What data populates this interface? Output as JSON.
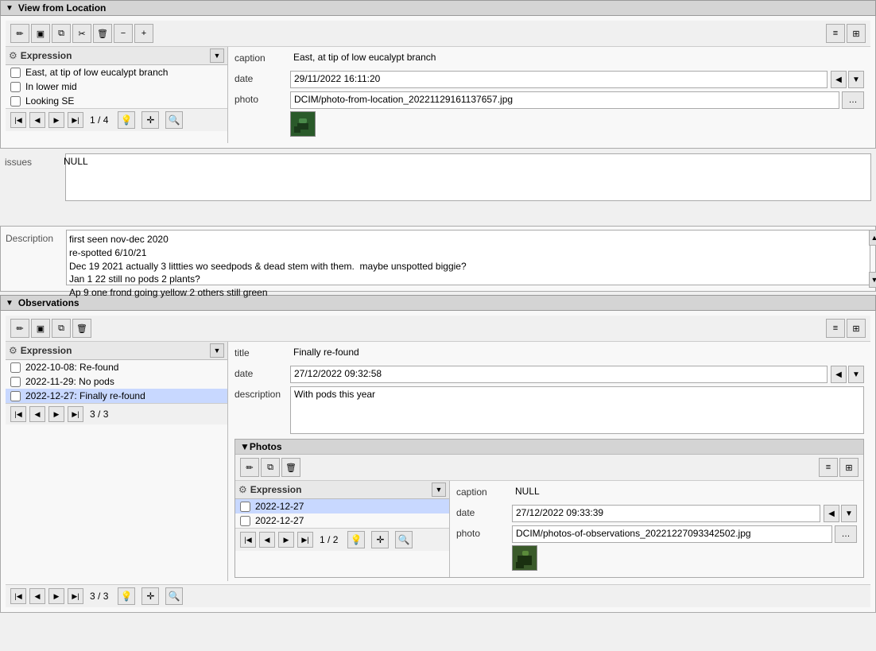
{
  "viewFromLocation": {
    "header": "View from Location",
    "toolbar": {
      "edit_icon": "✏️",
      "save_icon": "💾",
      "copy_icon": "📋",
      "delete_icon": "🗑",
      "minus_icon": "−",
      "plus_icon": "+",
      "table_icon": "≡",
      "grid_icon": "⊞"
    },
    "expression": {
      "label": "Expression",
      "items": [
        {
          "id": 1,
          "text": "East, at tip of low eucalypt branch",
          "checked": false
        },
        {
          "id": 2,
          "text": "In lower mid",
          "checked": false
        },
        {
          "id": 3,
          "text": "Looking SE",
          "checked": false
        }
      ]
    },
    "nav": {
      "current": "1",
      "total": "4"
    },
    "fields": {
      "caption_label": "caption",
      "caption_value": "East, at tip of low eucalypt branch",
      "date_label": "date",
      "date_value": "29/11/2022 16:11:20",
      "photo_label": "photo",
      "photo_path": "DCIM/photo-from-location_20221129161137657.jpg"
    }
  },
  "issues": {
    "label": "issues",
    "value": "NULL"
  },
  "description": {
    "label": "Description",
    "lines": [
      "first seen nov-dec 2020",
      "re-spotted 6/10/21",
      "Dec 19 2021 actually 3 littties wo seedpods & dead stem with them.  maybe unspotted biggie?",
      "Jan 1 22 still no pods 2 plants?",
      "Ap 9 one frond going yellow 2 others still green"
    ]
  },
  "observations": {
    "header": "Observations",
    "toolbar": {
      "edit_icon": "✏️",
      "save_icon": "💾",
      "copy_icon": "📋",
      "delete_icon": "🗑"
    },
    "expression": {
      "label": "Expression",
      "items": [
        {
          "id": 1,
          "text": "2022-10-08: Re-found",
          "checked": false
        },
        {
          "id": 2,
          "text": "2022-11-29: No pods",
          "checked": false
        },
        {
          "id": 3,
          "text": "2022-12-27: Finally re-found",
          "checked": false
        }
      ]
    },
    "nav": {
      "current": "3",
      "total": "3"
    },
    "fields": {
      "title_label": "title",
      "title_value": "Finally re-found",
      "date_label": "date",
      "date_value": "27/12/2022 09:32:58",
      "description_label": "description",
      "description_value": "With pods this year"
    },
    "photos": {
      "header": "Photos",
      "toolbar": {
        "edit_icon": "✏️",
        "copy_icon": "📋",
        "delete_icon": "🗑"
      },
      "expression": {
        "label": "Expression",
        "items": [
          {
            "id": 1,
            "text": "2022-12-27",
            "checked": false
          },
          {
            "id": 2,
            "text": "2022-12-27",
            "checked": false
          }
        ]
      },
      "nav": {
        "current": "1",
        "total": "2"
      },
      "fields": {
        "caption_label": "caption",
        "caption_value": "NULL",
        "date_label": "date",
        "date_value": "27/12/2022 09:33:39",
        "photo_label": "photo",
        "photo_path": "DCIM/photos-of-observations_20221227093342502.jpg"
      }
    }
  },
  "bottom_nav": {
    "current": "3",
    "total": "3"
  }
}
